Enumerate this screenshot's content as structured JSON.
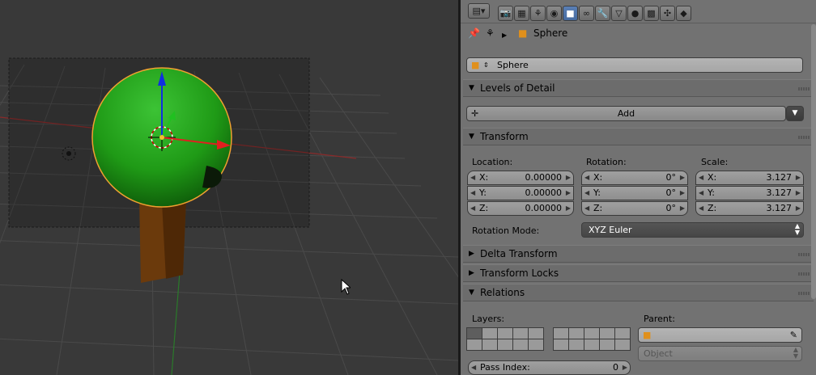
{
  "header_tabs": {
    "icons": [
      "render-icon",
      "render-layers-icon",
      "scene-icon",
      "world-icon",
      "object-icon",
      "constraints-icon",
      "modifiers-icon",
      "data-icon",
      "material-icon",
      "texture-icon",
      "particles-icon",
      "physics-icon"
    ],
    "active": "object-icon"
  },
  "context": {
    "object_name": "Sphere"
  },
  "object_field": {
    "value": "Sphere"
  },
  "panels": {
    "lod": {
      "title": "Levels of Detail",
      "add_label": "Add"
    },
    "transform": {
      "title": "Transform",
      "location_label": "Location:",
      "rotation_label": "Rotation:",
      "scale_label": "Scale:",
      "location": [
        {
          "k": "X:",
          "v": "0.00000"
        },
        {
          "k": "Y:",
          "v": "0.00000"
        },
        {
          "k": "Z:",
          "v": "0.00000"
        }
      ],
      "rotation": [
        {
          "k": "X:",
          "v": "0°"
        },
        {
          "k": "Y:",
          "v": "0°"
        },
        {
          "k": "Z:",
          "v": "0°"
        }
      ],
      "scale": [
        {
          "k": "X:",
          "v": "3.127"
        },
        {
          "k": "Y:",
          "v": "3.127"
        },
        {
          "k": "Z:",
          "v": "3.127"
        }
      ],
      "rotation_mode_label": "Rotation Mode:",
      "rotation_mode_value": "XYZ Euler"
    },
    "delta": {
      "title": "Delta Transform"
    },
    "locks": {
      "title": "Transform Locks"
    },
    "relations": {
      "title": "Relations",
      "layers_label": "Layers:",
      "parent_label": "Parent:",
      "parent_type": "Object",
      "pass_index_label": "Pass Index:",
      "pass_index_value": "0"
    }
  },
  "colors": {
    "sphere": "#1f9a16",
    "selection_outline": "#f0a030",
    "active_tab": "#4a6fa5",
    "axis_x": "#e02020",
    "axis_y": "#20c020",
    "axis_z": "#1030e0"
  }
}
